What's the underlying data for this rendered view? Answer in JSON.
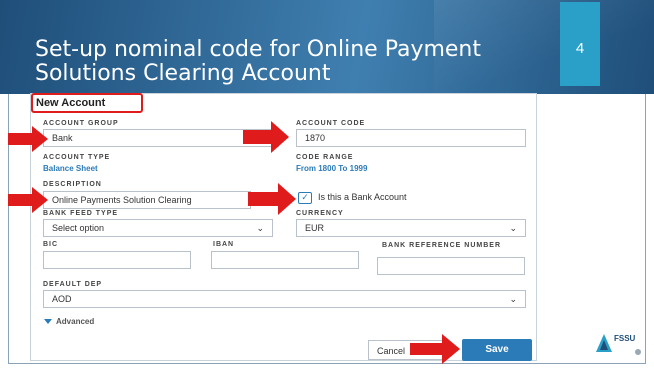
{
  "slide": {
    "title": "Set-up nominal code for Online Payment Solutions Clearing Account",
    "page_number": "4"
  },
  "form": {
    "heading": "New Account",
    "account_group_label": "ACCOUNT GROUP",
    "account_group_value": "Bank",
    "account_code_label": "ACCOUNT CODE",
    "account_code_value": "1870",
    "account_type_label": "ACCOUNT TYPE",
    "account_type_value": "Balance Sheet",
    "code_range_label": "CODE RANGE",
    "code_range_value": "From 1800 To 1999",
    "description_label": "DESCRIPTION",
    "description_value": "Online Payments Solution Clearing",
    "bank_account_checkbox_label": "Is this a Bank Account",
    "bank_account_checked": true,
    "bank_feed_type_label": "BANK FEED TYPE",
    "bank_feed_type_value": "Select option",
    "currency_label": "CURRENCY",
    "currency_value": "EUR",
    "bic_label": "BIC",
    "iban_label": "IBAN",
    "bank_reference_label": "BANK REFERENCE NUMBER",
    "default_dep_label": "DEFAULT DEP",
    "default_dep_value": "AOD",
    "advanced_label": "Advanced",
    "cancel_label": "Cancel",
    "save_label": "Save"
  },
  "logo": {
    "name": "FSSU"
  },
  "colors": {
    "banner": "#1f4e79",
    "page_box": "#2a9fc7",
    "highlight": "#e01b1b",
    "accent": "#2b7bb9"
  }
}
